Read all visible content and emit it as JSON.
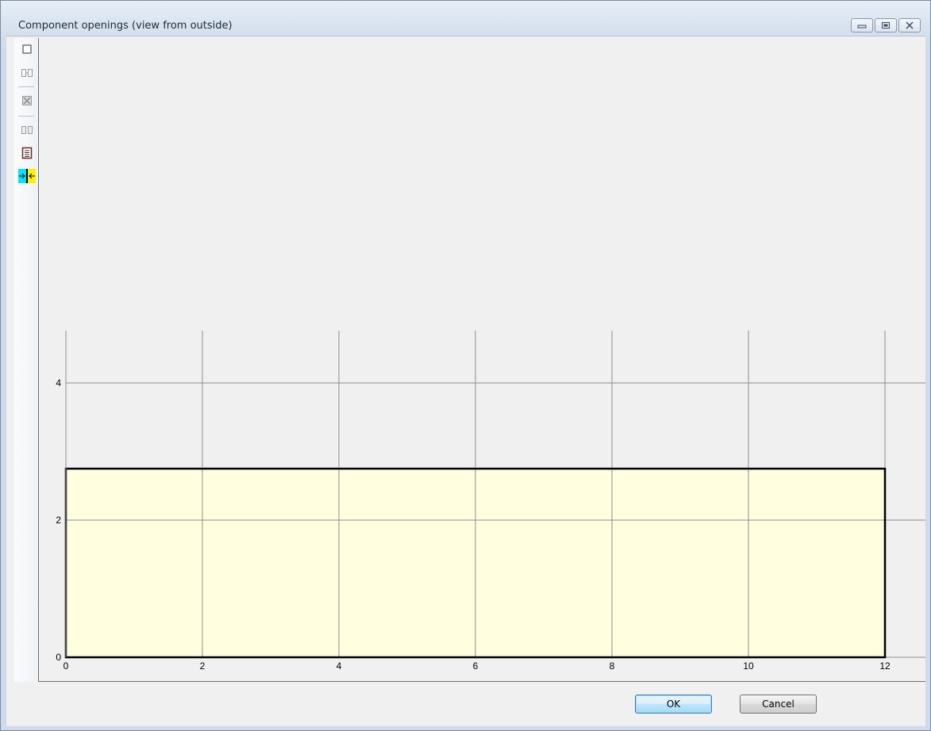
{
  "window": {
    "title": "Component openings (view from outside)",
    "controls": [
      "minimize",
      "restore",
      "close"
    ]
  },
  "toolbar": {
    "items": [
      {
        "icon": "new-opening-icon",
        "enabled": true
      },
      {
        "icon": "split-icon",
        "enabled": false
      },
      {
        "icon": "delete-icon",
        "enabled": false
      },
      {
        "icon": "duplicate-icon",
        "enabled": false
      },
      {
        "icon": "properties-icon",
        "enabled": true
      },
      {
        "icon": "fit-width-icon",
        "enabled": true
      }
    ]
  },
  "chart_data": {
    "type": "area",
    "x_ticks": [
      "0",
      "2",
      "4",
      "6",
      "8",
      "10",
      "12"
    ],
    "y_ticks": [
      "0",
      "2",
      "4"
    ],
    "xlim": [
      0,
      12
    ],
    "ylim": [
      0,
      4.8
    ],
    "grid": true,
    "component": {
      "x0": 0,
      "x1": 12,
      "y0": 0,
      "y1": 2.75,
      "fill": "#ffffe0",
      "stroke": "#000000"
    },
    "grid_color": "#8c8c8c"
  },
  "buttons": {
    "ok": "OK",
    "cancel": "Cancel"
  }
}
